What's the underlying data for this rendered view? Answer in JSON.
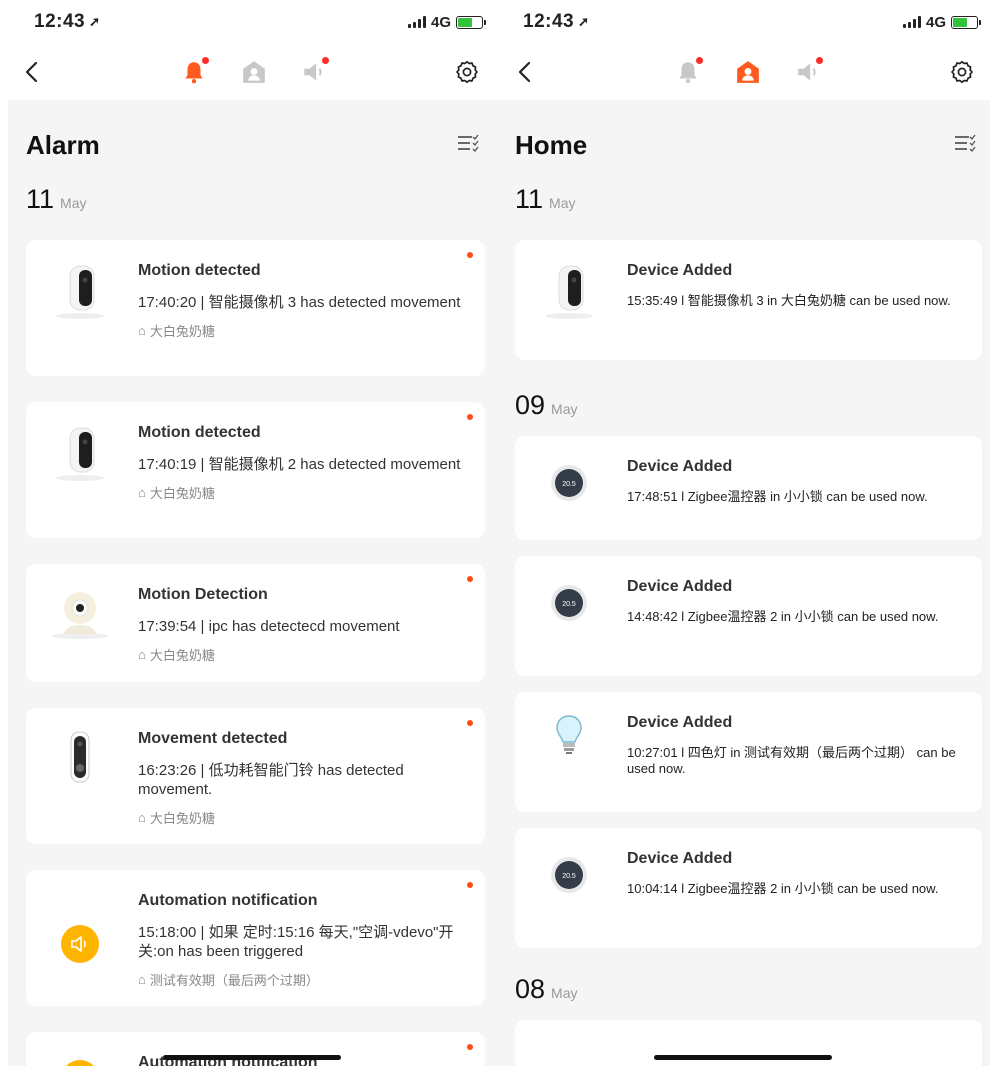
{
  "status": {
    "time": "12:43",
    "network": "4G"
  },
  "left": {
    "title": "Alarm",
    "date": {
      "day": "11",
      "month": "May"
    },
    "cards": [
      {
        "title": "Motion detected",
        "desc": "17:40:20 | 智能摄像机 3 has detected movement",
        "home": "大白兔奶糖",
        "icon": "camera-icon"
      },
      {
        "title": "Motion detected",
        "desc": "17:40:19 | 智能摄像机 2 has detected movement",
        "home": "大白兔奶糖",
        "icon": "camera-icon"
      },
      {
        "title": "Motion Detection",
        "desc": "17:39:54 | ipc has detectecd movement",
        "home": "大白兔奶糖",
        "icon": "ipc-camera-icon"
      },
      {
        "title": "Movement detected",
        "desc": "16:23:26 | 低功耗智能门铃 has detected movement.",
        "home": "大白兔奶糖",
        "icon": "doorbell-icon"
      },
      {
        "title": "Automation notification",
        "desc": "15:18:00 | 如果 定时:15:16 每天,\"空调-vdevo\"开关:on has been triggered",
        "home": "测试有效期（最后两个过期）",
        "icon": "speaker-automation-icon"
      },
      {
        "title": "Automation notification",
        "icon": "speaker-automation-icon"
      }
    ]
  },
  "right": {
    "title": "Home",
    "groups": [
      {
        "day": "11",
        "month": "May",
        "cards": [
          {
            "title": "Device Added",
            "desc": "15:35:49 l 智能摄像机 3 in 大白兔奶糖 can be used now.",
            "icon": "camera-icon"
          }
        ]
      },
      {
        "day": "09",
        "month": "May",
        "cards": [
          {
            "title": "Device Added",
            "desc": "17:48:51 l Zigbee温控器 in 小小锁 can be used now.",
            "icon": "thermostat-icon"
          },
          {
            "title": "Device Added",
            "desc": "14:48:42 l Zigbee温控器 2 in 小小锁 can be used now.",
            "icon": "thermostat-icon"
          },
          {
            "title": "Device Added",
            "desc": "10:27:01 l 四色灯 in 测试有效期（最后两个过期） can be used now.",
            "icon": "bulb-icon"
          },
          {
            "title": "Device Added",
            "desc": "10:04:14 l Zigbee温控器 2 in 小小锁 can be used now.",
            "icon": "thermostat-icon"
          }
        ]
      },
      {
        "day": "08",
        "month": "May",
        "cards": []
      }
    ]
  },
  "thermostat_reading": "20.5",
  "colors": {
    "accent": "#ff5a1f",
    "inactive": "#c8c8c8",
    "badge": "#ff2a2a",
    "unread": "#ff4b14",
    "automation": "#ffb400"
  }
}
